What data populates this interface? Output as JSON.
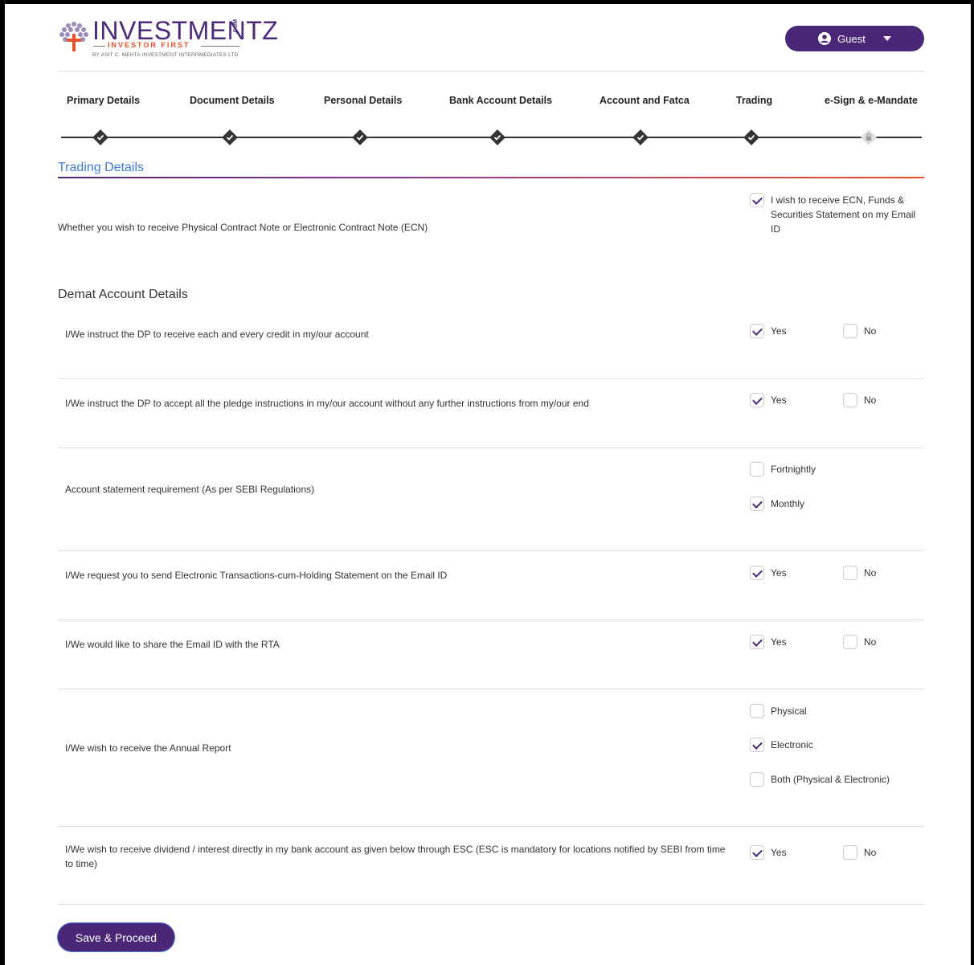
{
  "brand": {
    "name": "INVESTMENTZ",
    "suffix": ".COM",
    "tagline": "INVESTOR FIRST",
    "by_line": "BY ASIT C. MEHTA INVESTMENT INTERRMEDIATES LTD",
    "primary_color": "#4a2877",
    "accent_color": "#e8502a"
  },
  "header": {
    "user_label": "Guest",
    "user_icon": "user-circle-icon",
    "menu_icon": "caret-down-icon"
  },
  "stepper": {
    "steps": [
      {
        "label": "Primary Details",
        "state": "done"
      },
      {
        "label": "Document Details",
        "state": "done"
      },
      {
        "label": "Personal Details",
        "state": "done"
      },
      {
        "label": "Bank Account Details",
        "state": "done"
      },
      {
        "label": "Account and Fatca",
        "state": "done"
      },
      {
        "label": "Trading",
        "state": "done"
      },
      {
        "label": "e-Sign & e-Mandate",
        "state": "locked"
      }
    ]
  },
  "trading": {
    "section_title": "Trading Details",
    "ecn_question": "Whether you wish to receive Physical Contract Note or Electronic Contract Note (ECN)",
    "ecn_option": "I wish to receive ECN, Funds & Securities Statement on my Email ID",
    "ecn_checked": true
  },
  "demat": {
    "title": "Demat Account Details",
    "q1": {
      "text": "I/We instruct the DP to receive each and every credit in my/our account",
      "yes": "Yes",
      "no": "No",
      "selected": "Yes"
    },
    "q2": {
      "text": "I/We instruct the DP to accept all the pledge instructions in my/our account without any further instructions from my/our end",
      "yes": "Yes",
      "no": "No",
      "selected": "Yes"
    },
    "q3": {
      "text": "Account statement requirement (As per SEBI Regulations)",
      "opt1": "Fortnightly",
      "opt2": "Monthly",
      "selected": "Monthly"
    },
    "q4": {
      "text": "I/We request you to send Electronic Transactions-cum-Holding Statement on the Email ID",
      "yes": "Yes",
      "no": "No",
      "selected": "Yes"
    },
    "q5": {
      "text": "I/We would like to share the Email ID with the RTA",
      "yes": "Yes",
      "no": "No",
      "selected": "Yes"
    },
    "q6": {
      "text": "I/We wish to receive the Annual Report",
      "opt1": "Physical",
      "opt2": "Electronic",
      "opt3": "Both (Physical & Electronic)",
      "selected": "Electronic"
    },
    "q7": {
      "text": "I/We wish to receive dividend / interest directly in my bank account as given below through ESC (ESC is mandatory for locations notified by SEBI from time to time)",
      "yes": "Yes",
      "no": "No",
      "selected": "Yes"
    }
  },
  "actions": {
    "save_label": "Save & Proceed"
  }
}
